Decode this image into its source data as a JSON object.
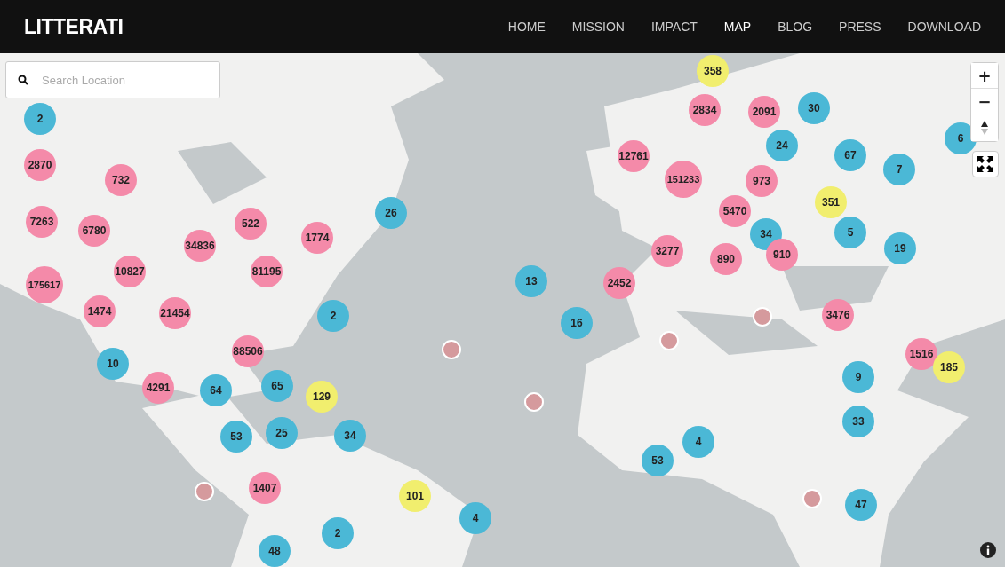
{
  "header": {
    "logo": "LITTERATI",
    "nav": [
      {
        "label": "HOME",
        "selected": false
      },
      {
        "label": "MISSION",
        "selected": false
      },
      {
        "label": "IMPACT",
        "selected": false
      },
      {
        "label": "MAP",
        "selected": true
      },
      {
        "label": "BLOG",
        "selected": false
      },
      {
        "label": "PRESS",
        "selected": false
      },
      {
        "label": "DOWNLOAD",
        "selected": false
      }
    ]
  },
  "search": {
    "placeholder": "Search Location"
  },
  "map": {
    "zoom_controls": [
      "+",
      "−"
    ],
    "clusters": [
      {
        "count": "358",
        "color": "#f1ee6e"
      },
      {
        "count": "2",
        "color": "#4bb8d6"
      },
      {
        "count": "2834",
        "color": "#f48aa9"
      },
      {
        "count": "2091",
        "color": "#f48aa9"
      },
      {
        "count": "30",
        "color": "#4bb8d6"
      },
      {
        "count": "6",
        "color": "#4bb8d6"
      },
      {
        "count": "24",
        "color": "#4bb8d6"
      },
      {
        "count": "12761",
        "color": "#f48aa9"
      },
      {
        "count": "67",
        "color": "#4bb8d6"
      },
      {
        "count": "2870",
        "color": "#f48aa9"
      },
      {
        "count": "7",
        "color": "#4bb8d6"
      },
      {
        "count": "732",
        "color": "#f48aa9"
      },
      {
        "count": "151233",
        "color": "#f48aa9"
      },
      {
        "count": "973",
        "color": "#f48aa9"
      },
      {
        "count": "351",
        "color": "#f1ee6e"
      },
      {
        "count": "26",
        "color": "#4bb8d6"
      },
      {
        "count": "5470",
        "color": "#f48aa9"
      },
      {
        "count": "7263",
        "color": "#f48aa9"
      },
      {
        "count": "6780",
        "color": "#f48aa9"
      },
      {
        "count": "522",
        "color": "#f48aa9"
      },
      {
        "count": "1774",
        "color": "#f48aa9"
      },
      {
        "count": "34",
        "color": "#4bb8d6"
      },
      {
        "count": "5",
        "color": "#4bb8d6"
      },
      {
        "count": "34836",
        "color": "#f48aa9"
      },
      {
        "count": "3277",
        "color": "#f48aa9"
      },
      {
        "count": "890",
        "color": "#f48aa9"
      },
      {
        "count": "910",
        "color": "#f48aa9"
      },
      {
        "count": "19",
        "color": "#4bb8d6"
      },
      {
        "count": "10827",
        "color": "#f48aa9"
      },
      {
        "count": "81195",
        "color": "#f48aa9"
      },
      {
        "count": "175617",
        "color": "#f48aa9"
      },
      {
        "count": "13",
        "color": "#4bb8d6"
      },
      {
        "count": "2452",
        "color": "#f48aa9"
      },
      {
        "count": "1474",
        "color": "#f48aa9"
      },
      {
        "count": "21454",
        "color": "#f48aa9"
      },
      {
        "count": "2",
        "color": "#4bb8d6"
      },
      {
        "count": "16",
        "color": "#4bb8d6"
      },
      {
        "count": "3476",
        "color": "#f48aa9"
      },
      {
        "count": "88506",
        "color": "#f48aa9"
      },
      {
        "count": "1516",
        "color": "#f48aa9"
      },
      {
        "count": "10",
        "color": "#4bb8d6"
      },
      {
        "count": "185",
        "color": "#f1ee6e"
      },
      {
        "count": "9",
        "color": "#4bb8d6"
      },
      {
        "count": "4291",
        "color": "#f48aa9"
      },
      {
        "count": "64",
        "color": "#4bb8d6"
      },
      {
        "count": "65",
        "color": "#4bb8d6"
      },
      {
        "count": "129",
        "color": "#f1ee6e"
      },
      {
        "count": "33",
        "color": "#4bb8d6"
      },
      {
        "count": "53",
        "color": "#4bb8d6"
      },
      {
        "count": "25",
        "color": "#4bb8d6"
      },
      {
        "count": "34",
        "color": "#4bb8d6"
      },
      {
        "count": "4",
        "color": "#4bb8d6"
      },
      {
        "count": "53",
        "color": "#4bb8d6"
      },
      {
        "count": "1407",
        "color": "#f48aa9"
      },
      {
        "count": "101",
        "color": "#f1ee6e"
      },
      {
        "count": "47",
        "color": "#4bb8d6"
      },
      {
        "count": "4",
        "color": "#4bb8d6"
      },
      {
        "count": "2",
        "color": "#4bb8d6"
      },
      {
        "count": "48",
        "color": "#4bb8d6"
      }
    ]
  }
}
